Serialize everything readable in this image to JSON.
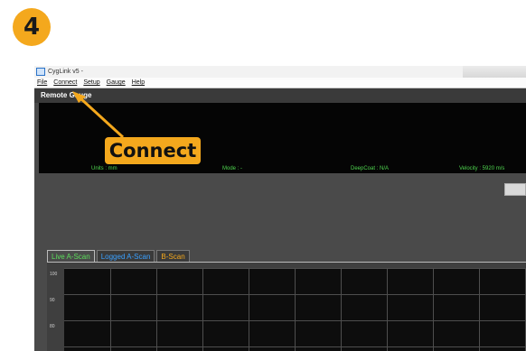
{
  "step_number": "4",
  "window": {
    "title": "CygLink v5 -",
    "menu": [
      "File",
      "Connect",
      "Setup",
      "Gauge",
      "Help"
    ]
  },
  "remote_gauge": {
    "header": "Remote Gauge",
    "units": "Units : mm",
    "mode": "Mode : -",
    "deepcoat": "DeepCoat : N/A",
    "velocity": "Velocity : 5920 m/s"
  },
  "tabs": [
    "Live A-Scan",
    "Logged A-Scan",
    "B-Scan"
  ],
  "plot": {
    "yticks": [
      "100",
      "90",
      "80"
    ]
  },
  "callout": {
    "label": "Connect"
  },
  "colors": {
    "accent": "#f4a81d",
    "status_green": "#4fd64f",
    "live_tab": "#5cdd5c",
    "logged_tab": "#3aa0ff"
  }
}
